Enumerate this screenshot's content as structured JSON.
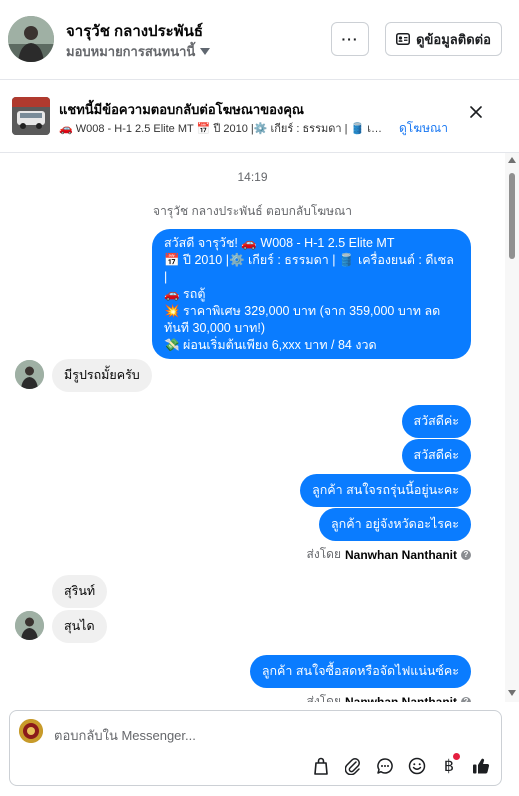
{
  "header": {
    "contact_name": "จารุวัช กลางประพันธ์",
    "assign_label": "มอบหมายการสนทนานี้",
    "more_label": "···",
    "details_label": "ดูข้อมูลติดต่อ"
  },
  "ad_banner": {
    "title": "แชทนี้มีข้อความตอบกลับต่อโฆษณาของคุณ",
    "subtitle": "🚗 W008 - H-1 2.5 Elite MT 📅 ปี 2010 |⚙️ เกียร์ : ธรรมดา | 🛢️ เครื่องยนต์ : ดีเซล |",
    "link": "ดูโฆษณา"
  },
  "chat": {
    "timestamp": "14:19",
    "reply_note": "จารุวัช กลางประพันธ์ ตอบกลับโฆษณา",
    "ad_message_lines": [
      "สวัสดี จารุวัช! 🚗 W008 - H-1 2.5 Elite MT",
      "📅 ปี 2010 |⚙️ เกียร์ : ธรรมดา | 🛢️ เครื่องยนต์ : ดีเซล |",
      "🚗 รถตู้",
      "💥 ราคาพิเศษ 329,000 บาท (จาก 359,000 บาท ลดทันที 30,000 บาท!)",
      "💸 ผ่อนเริ่มต้นเพียง 6,xxx บาท / 84 งวด"
    ],
    "incoming_1": "มีรูปรถมั้ยครับ",
    "outgoing": [
      "สวัสดีค่ะ",
      "สวัสดีค่ะ",
      "ลูกค้า  สนใจรถรุ่นนี้อยู่นะคะ",
      "ลูกค้า  อยู่จังหวัดอะไรคะ"
    ],
    "sent_by_label": "ส่งโดย",
    "sent_by_name": "Nanwhan Nanthanit",
    "incoming_2": "สุรินท์",
    "incoming_3": "สุนได",
    "outgoing_last": "ลูกค้า  สนใจซื้อสดหรือจัดไฟแน่นซ์คะ"
  },
  "composer": {
    "placeholder": "ตอบกลับใน Messenger..."
  },
  "colors": {
    "accent": "#0a7cff",
    "link": "#1877f2",
    "incoming_bubble": "#f0f0f0"
  },
  "icons": [
    "more-icon",
    "contact-card-icon",
    "close-icon",
    "bag-icon",
    "attach-icon",
    "chat-icon",
    "emoji-icon",
    "baht-icon",
    "thumbs-up-icon"
  ]
}
